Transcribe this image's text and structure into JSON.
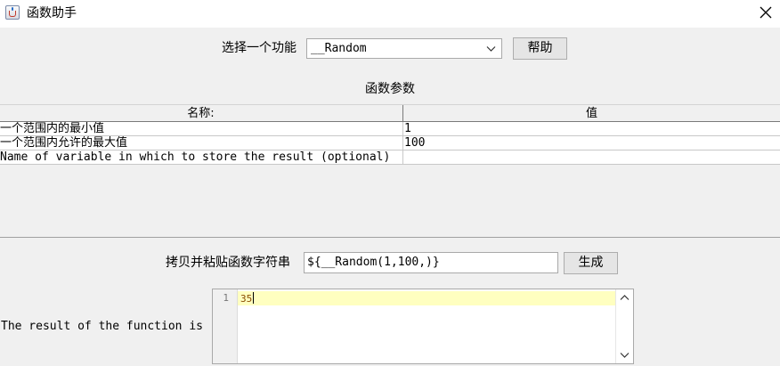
{
  "window": {
    "title": "函数助手"
  },
  "function_selector": {
    "label": "选择一个功能",
    "selected": "__Random",
    "help_button": "帮助"
  },
  "parameters": {
    "title": "函数参数",
    "columns": {
      "name": "名称:",
      "value": "值"
    },
    "rows": [
      {
        "name": "一个范围内的最小值",
        "value": "1"
      },
      {
        "name": "一个范围内允许的最大值",
        "value": "100"
      },
      {
        "name": "Name of variable in which to store the result (optional)",
        "value": ""
      }
    ]
  },
  "copy": {
    "label": "拷贝并粘贴函数字符串",
    "value": "${__Random(1,100,)}",
    "generate_button": "生成"
  },
  "result": {
    "label": "The result of the function is",
    "line_number": "1",
    "value": "35"
  },
  "icons": {
    "app": "java-cup-icon",
    "close": "close-icon",
    "dropdown": "chevron-down-icon",
    "scroll_up": "scroll-up-icon",
    "scroll_down": "scroll-down-icon"
  }
}
